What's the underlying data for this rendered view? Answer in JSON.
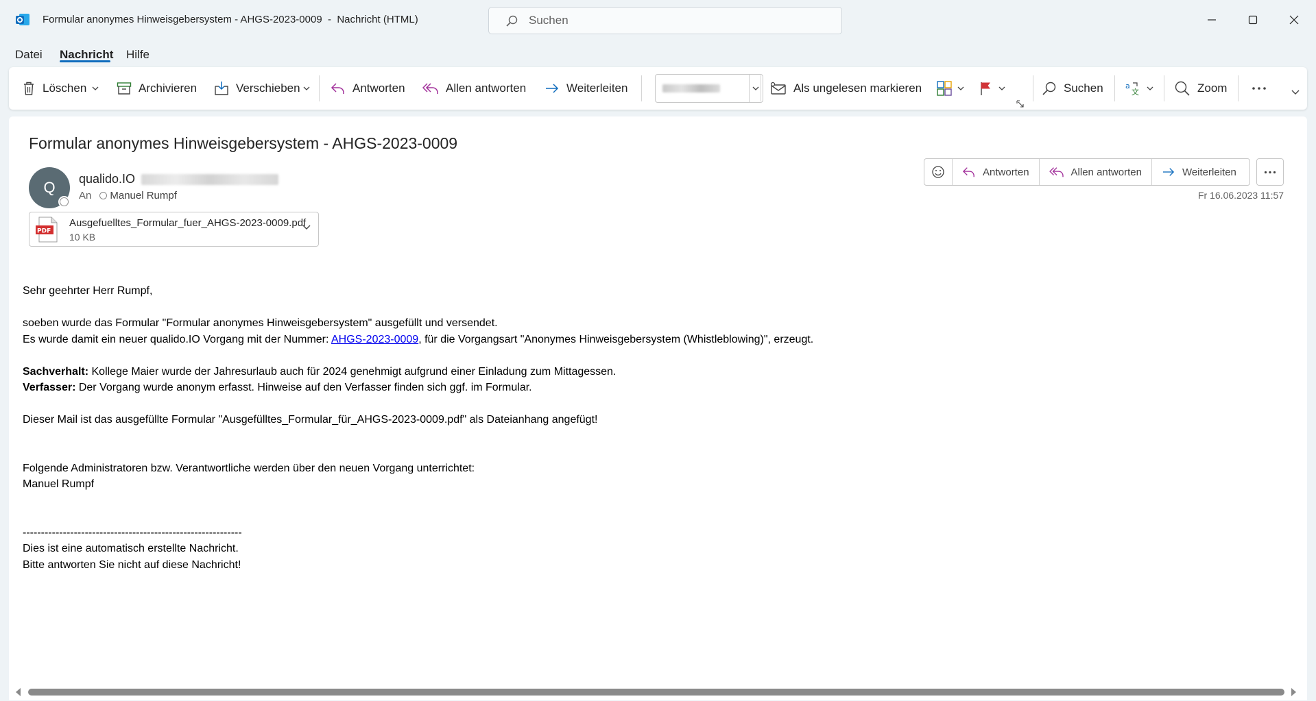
{
  "window": {
    "title": "Formular anonymes Hinweisgebersystem - AHGS-2023-0009  -  Nachricht (HTML)",
    "search_placeholder": "Suchen"
  },
  "menu": {
    "items": [
      {
        "label": "Datei",
        "active": false
      },
      {
        "label": "Nachricht",
        "active": true
      },
      {
        "label": "Hilfe",
        "active": false
      }
    ]
  },
  "ribbon": {
    "delete": "Löschen",
    "archive": "Archivieren",
    "move": "Verschieben",
    "reply": "Antworten",
    "reply_all": "Allen antworten",
    "forward": "Weiterleiten",
    "mark_unread": "Als ungelesen markieren",
    "search": "Suchen",
    "zoom": "Zoom"
  },
  "message": {
    "subject": "Formular anonymes Hinweisgebersystem - AHGS-2023-0009",
    "avatar_initial": "Q",
    "sender_name": "qualido.IO",
    "to_label": "An",
    "recipient": "Manuel Rumpf",
    "date": "Fr 16.06.2023 11:57",
    "actions": {
      "reply": "Antworten",
      "reply_all": "Allen antworten",
      "forward": "Weiterleiten"
    },
    "attachment": {
      "name": "Ausgefuelltes_Formular_fuer_AHGS-2023-0009.pdf",
      "size": "10 KB",
      "type_badge": "PDF"
    },
    "body": {
      "greeting": "Sehr geehrter Herr Rumpf,",
      "line1": "soeben wurde das Formular \"Formular anonymes Hinweisgebersystem\" ausgefüllt und versendet.",
      "line2_pre": "Es wurde damit ein neuer qualido.IO Vorgang mit der Nummer: ",
      "line2_link": "AHGS-2023-0009",
      "line2_post": ", für die Vorgangsart \"Anonymes Hinweisgebersystem (Whistleblowing)\", erzeugt.",
      "sachverhalt_label": "Sachverhalt:",
      "sachverhalt_text": " Kollege Maier wurde der Jahresurlaub auch für 2024 genehmigt aufgrund einer Einladung zum Mittagessen.",
      "verfasser_label": "Verfasser:",
      "verfasser_text": " Der Vorgang wurde anonym erfasst. Hinweise auf den Verfasser finden sich ggf. im Formular.",
      "attachment_note": "Dieser Mail ist das ausgefüllte Formular \"Ausgefülltes_Formular_für_AHGS-2023-0009.pdf\" als Dateianhang angefügt!",
      "admins_intro": "Folgende Administratoren bzw. Verantwortliche werden über den neuen Vorgang unterrichtet:",
      "admins_list": "Manuel Rumpf",
      "separator": "------------------------------------------------------------",
      "footer1": "Dies ist eine automatisch erstellte Nachricht.",
      "footer2": "Bitte antworten Sie nicht auf diese Nachricht!"
    }
  },
  "colors": {
    "accent": "#0f6cbd",
    "reply_purple": "#a2319b",
    "forward_blue": "#0f6cbd",
    "background": "#eef3f6"
  }
}
